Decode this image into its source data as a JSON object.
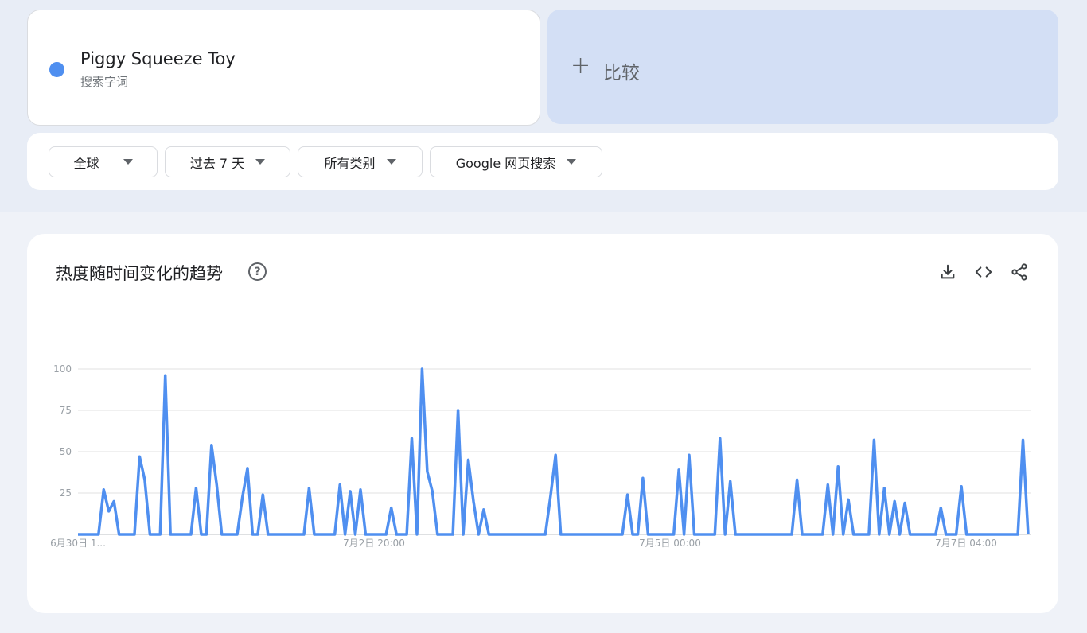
{
  "search_term": {
    "name": "Piggy Squeeze Toy",
    "type": "搜索字词",
    "color": "#4f8ff0"
  },
  "compare": {
    "plus": "+",
    "label": "比较"
  },
  "filters": {
    "region": "全球",
    "time_range": "过去 7 天",
    "category": "所有类别",
    "search_type": "Google 网页搜索"
  },
  "chart_section": {
    "title": "热度随时间变化的趋势",
    "help_icon": "help-circle-icon",
    "tools": [
      "download-icon",
      "embed-code-icon",
      "share-icon"
    ]
  },
  "chart_data": {
    "type": "line",
    "series": [
      {
        "color": "#4f8ff0",
        "values": [
          0,
          0,
          0,
          0,
          0,
          27,
          14,
          20,
          0,
          0,
          0,
          0,
          47,
          33,
          0,
          0,
          0,
          96,
          0,
          0,
          0,
          0,
          0,
          28,
          0,
          0,
          54,
          30,
          0,
          0,
          0,
          0,
          22,
          40,
          0,
          0,
          24,
          0,
          0,
          0,
          0,
          0,
          0,
          0,
          0,
          28,
          0,
          0,
          0,
          0,
          0,
          30,
          0,
          26,
          0,
          27,
          0,
          0,
          0,
          0,
          0,
          16,
          0,
          0,
          0,
          58,
          0,
          100,
          38,
          26,
          0,
          0,
          0,
          0,
          75,
          0,
          45,
          20,
          0,
          15,
          0,
          0,
          0,
          0,
          0,
          0,
          0,
          0,
          0,
          0,
          0,
          0,
          23,
          48,
          0,
          0,
          0,
          0,
          0,
          0,
          0,
          0,
          0,
          0,
          0,
          0,
          0,
          24,
          0,
          0,
          34,
          0,
          0,
          0,
          0,
          0,
          0,
          39,
          0,
          48,
          0,
          0,
          0,
          0,
          0,
          58,
          0,
          32,
          0,
          0,
          0,
          0,
          0,
          0,
          0,
          0,
          0,
          0,
          0,
          0,
          33,
          0,
          0,
          0,
          0,
          0,
          30,
          0,
          41,
          0,
          21,
          0,
          0,
          0,
          0,
          57,
          0,
          28,
          0,
          20,
          0,
          19,
          0,
          0,
          0,
          0,
          0,
          0,
          16,
          0,
          0,
          0,
          29,
          0,
          0,
          0,
          0,
          0,
          0,
          0,
          0,
          0,
          0,
          0,
          57,
          0
        ]
      }
    ],
    "x_tick_labels": [
      "6月30日 1...",
      "7月2日 20:00",
      "7月5日 00:00",
      "7月7日 04:00"
    ],
    "y_ticks": [
      0,
      25,
      50,
      75,
      100
    ],
    "y_tick_labels": [
      "",
      "25",
      "50",
      "75",
      "100"
    ],
    "ylim": [
      0,
      100
    ],
    "grid": true
  }
}
